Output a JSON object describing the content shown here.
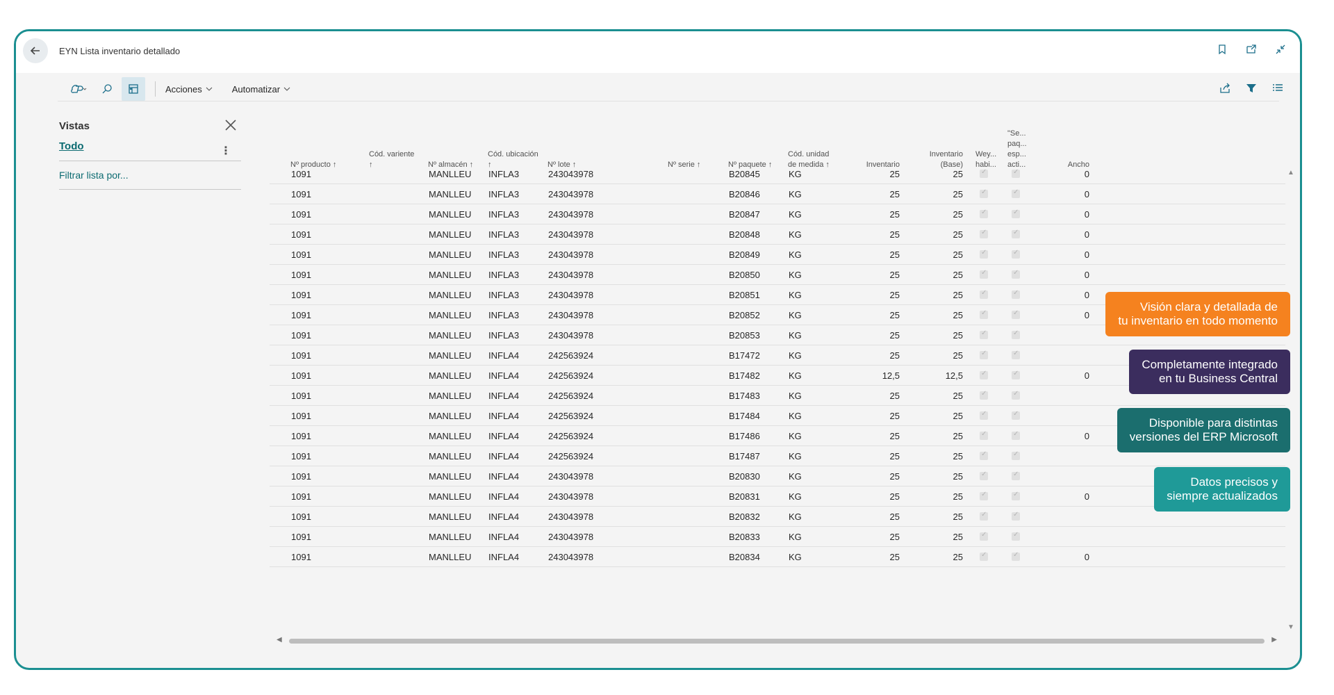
{
  "window": {
    "title": "EYN Lista inventario detallado"
  },
  "toolbar": {
    "acciones_label": "Acciones",
    "automatizar_label": "Automatizar"
  },
  "views": {
    "title": "Vistas",
    "todo_label": "Todo",
    "filter_label": "Filtrar lista por..."
  },
  "columns": {
    "producto": "Nº producto ↑",
    "variante_1": "Cód. variente",
    "variante_2": "↑",
    "almacen": "Nº almacén ↑",
    "ubicacion_1": "Cód. ubicación",
    "ubicacion_2": "↑",
    "lote": "Nº lote ↑",
    "serie": "Nº serie ↑",
    "paquete": "Nº paquete ↑",
    "unidad_1": "Cód. unidad",
    "unidad_2": "de medida ↑",
    "inventario": "Inventario",
    "inventario_base_1": "Inventario",
    "inventario_base_2": "(Base)",
    "wey_1": "Wey...",
    "wey_2": "habi...",
    "se_1": "\"Se...",
    "se_2": "paq...",
    "se_3": "esp...",
    "se_4": "acti...",
    "ancho": "Ancho"
  },
  "rows": [
    {
      "producto": "1091",
      "almacen": "MANLLEU",
      "ubicacion": "INFLA3",
      "lote": "243043978",
      "paquete": "B20845",
      "unidad": "KG",
      "inventario": "25",
      "inventario_base": "25",
      "ancho": "0"
    },
    {
      "producto": "1091",
      "almacen": "MANLLEU",
      "ubicacion": "INFLA3",
      "lote": "243043978",
      "paquete": "B20846",
      "unidad": "KG",
      "inventario": "25",
      "inventario_base": "25",
      "ancho": "0"
    },
    {
      "producto": "1091",
      "almacen": "MANLLEU",
      "ubicacion": "INFLA3",
      "lote": "243043978",
      "paquete": "B20847",
      "unidad": "KG",
      "inventario": "25",
      "inventario_base": "25",
      "ancho": "0"
    },
    {
      "producto": "1091",
      "almacen": "MANLLEU",
      "ubicacion": "INFLA3",
      "lote": "243043978",
      "paquete": "B20848",
      "unidad": "KG",
      "inventario": "25",
      "inventario_base": "25",
      "ancho": "0"
    },
    {
      "producto": "1091",
      "almacen": "MANLLEU",
      "ubicacion": "INFLA3",
      "lote": "243043978",
      "paquete": "B20849",
      "unidad": "KG",
      "inventario": "25",
      "inventario_base": "25",
      "ancho": "0"
    },
    {
      "producto": "1091",
      "almacen": "MANLLEU",
      "ubicacion": "INFLA3",
      "lote": "243043978",
      "paquete": "B20850",
      "unidad": "KG",
      "inventario": "25",
      "inventario_base": "25",
      "ancho": "0"
    },
    {
      "producto": "1091",
      "almacen": "MANLLEU",
      "ubicacion": "INFLA3",
      "lote": "243043978",
      "paquete": "B20851",
      "unidad": "KG",
      "inventario": "25",
      "inventario_base": "25",
      "ancho": "0"
    },
    {
      "producto": "1091",
      "almacen": "MANLLEU",
      "ubicacion": "INFLA3",
      "lote": "243043978",
      "paquete": "B20852",
      "unidad": "KG",
      "inventario": "25",
      "inventario_base": "25",
      "ancho": "0"
    },
    {
      "producto": "1091",
      "almacen": "MANLLEU",
      "ubicacion": "INFLA3",
      "lote": "243043978",
      "paquete": "B20853",
      "unidad": "KG",
      "inventario": "25",
      "inventario_base": "25",
      "ancho": ""
    },
    {
      "producto": "1091",
      "almacen": "MANLLEU",
      "ubicacion": "INFLA4",
      "lote": "242563924",
      "paquete": "B17472",
      "unidad": "KG",
      "inventario": "25",
      "inventario_base": "25",
      "ancho": ""
    },
    {
      "producto": "1091",
      "almacen": "MANLLEU",
      "ubicacion": "INFLA4",
      "lote": "242563924",
      "paquete": "B17482",
      "unidad": "KG",
      "inventario": "12,5",
      "inventario_base": "12,5",
      "ancho": "0"
    },
    {
      "producto": "1091",
      "almacen": "MANLLEU",
      "ubicacion": "INFLA4",
      "lote": "242563924",
      "paquete": "B17483",
      "unidad": "KG",
      "inventario": "25",
      "inventario_base": "25",
      "ancho": ""
    },
    {
      "producto": "1091",
      "almacen": "MANLLEU",
      "ubicacion": "INFLA4",
      "lote": "242563924",
      "paquete": "B17484",
      "unidad": "KG",
      "inventario": "25",
      "inventario_base": "25",
      "ancho": ""
    },
    {
      "producto": "1091",
      "almacen": "MANLLEU",
      "ubicacion": "INFLA4",
      "lote": "242563924",
      "paquete": "B17486",
      "unidad": "KG",
      "inventario": "25",
      "inventario_base": "25",
      "ancho": "0"
    },
    {
      "producto": "1091",
      "almacen": "MANLLEU",
      "ubicacion": "INFLA4",
      "lote": "242563924",
      "paquete": "B17487",
      "unidad": "KG",
      "inventario": "25",
      "inventario_base": "25",
      "ancho": ""
    },
    {
      "producto": "1091",
      "almacen": "MANLLEU",
      "ubicacion": "INFLA4",
      "lote": "243043978",
      "paquete": "B20830",
      "unidad": "KG",
      "inventario": "25",
      "inventario_base": "25",
      "ancho": ""
    },
    {
      "producto": "1091",
      "almacen": "MANLLEU",
      "ubicacion": "INFLA4",
      "lote": "243043978",
      "paquete": "B20831",
      "unidad": "KG",
      "inventario": "25",
      "inventario_base": "25",
      "ancho": "0"
    },
    {
      "producto": "1091",
      "almacen": "MANLLEU",
      "ubicacion": "INFLA4",
      "lote": "243043978",
      "paquete": "B20832",
      "unidad": "KG",
      "inventario": "25",
      "inventario_base": "25",
      "ancho": ""
    },
    {
      "producto": "1091",
      "almacen": "MANLLEU",
      "ubicacion": "INFLA4",
      "lote": "243043978",
      "paquete": "B20833",
      "unidad": "KG",
      "inventario": "25",
      "inventario_base": "25",
      "ancho": ""
    },
    {
      "producto": "1091",
      "almacen": "MANLLEU",
      "ubicacion": "INFLA4",
      "lote": "243043978",
      "paquete": "B20834",
      "unidad": "KG",
      "inventario": "25",
      "inventario_base": "25",
      "ancho": "0"
    }
  ],
  "callouts": [
    {
      "line1": "Visión clara y detallada de",
      "line2": "tu inventario en todo momento",
      "color": "#f5821f"
    },
    {
      "line1": "Completamente integrado",
      "line2": "en tu Business Central",
      "color": "#3b2d5e"
    },
    {
      "line1": "Disponible para distintas",
      "line2": "versiones del ERP Microsoft",
      "color": "#1b6e6e"
    },
    {
      "line1": "Datos precisos y",
      "line2": "siempre actualizados",
      "color": "#1f9a98"
    }
  ],
  "colors": {
    "frame": "#1b8f91",
    "link": "#0c6b71"
  },
  "icons": [
    "back-arrow-icon",
    "bookmark-icon",
    "open-new-window-icon",
    "collapse-icon",
    "copilot-icon",
    "search-icon",
    "show-as-table-icon",
    "chevron-down-icon",
    "share-icon",
    "filter-icon",
    "list-icon",
    "close-icon",
    "more-options-icon"
  ]
}
